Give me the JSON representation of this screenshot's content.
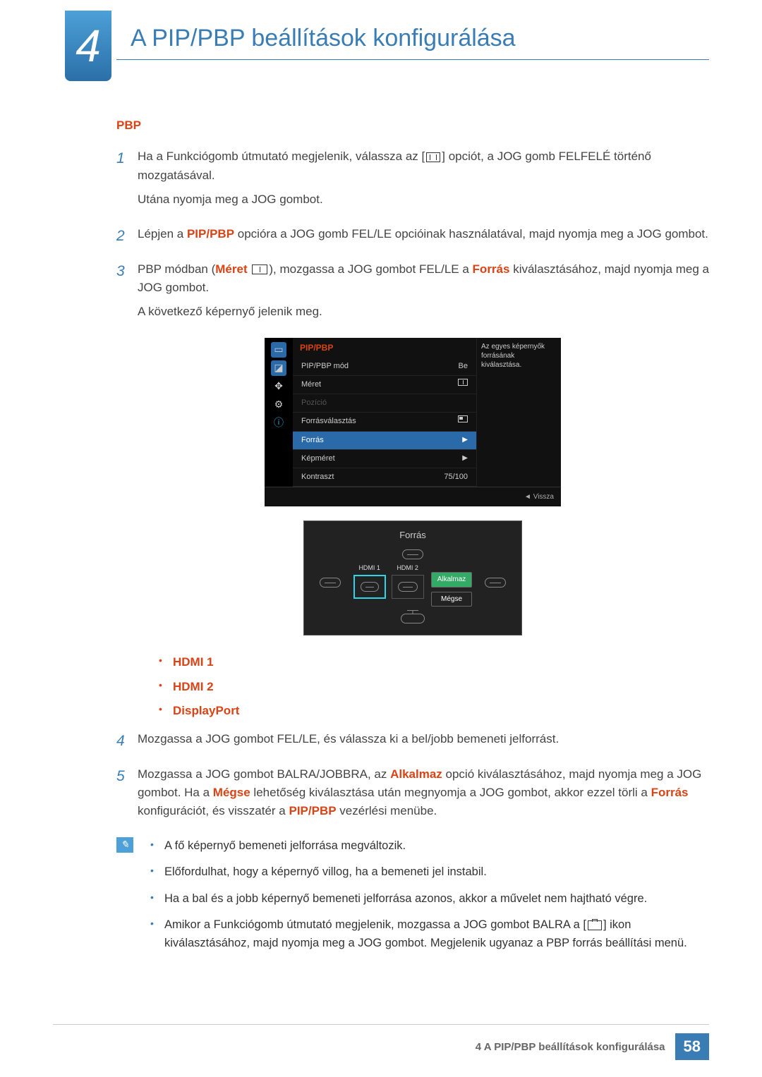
{
  "header": {
    "chapter_number": "4",
    "chapter_title": "A PIP/PBP beállítások konfigurálása"
  },
  "section_label": "PBP",
  "steps": {
    "s1": {
      "num": "1",
      "line1_a": "Ha a Funkciógomb útmutató megjelenik, válassza az [",
      "line1_b": "] opciót, a JOG gomb FELFELÉ történő mozgatásával.",
      "line2": "Utána nyomja meg a JOG gombot."
    },
    "s2": {
      "num": "2",
      "line1_a": "Lépjen a ",
      "kw1": "PIP/PBP",
      "line1_b": " opcióra a JOG gomb FEL/LE opcióinak használatával, majd nyomja meg a JOG gombot."
    },
    "s3": {
      "num": "3",
      "line1_a": "PBP módban (",
      "kw1": "Méret",
      "line1_b": " ",
      "line1_c": "), mozgassa a JOG gombot FEL/LE a ",
      "kw2": "Forrás",
      "line1_d": " kiválasztásához, majd nyomja meg a JOG gombot.",
      "line2": "A következő képernyő jelenik meg."
    },
    "s4": {
      "num": "4",
      "text": "Mozgassa a JOG gombot FEL/LE, és válassza ki a bel/jobb bemeneti jelforrást."
    },
    "s5": {
      "num": "5",
      "line1_a": "Mozgassa a JOG gombot BALRA/JOBBRA, az ",
      "kw1": "Alkalmaz",
      "line1_b": " opció kiválasztásához, majd nyomja meg a JOG gombot. Ha a ",
      "kw2": "Mégse",
      "line1_c": " lehetőség kiválasztása után megnyomja a JOG gombot, akkor ezzel törli a ",
      "kw3": "Forrás",
      "line1_d": " konfigurációt, és visszatér a ",
      "kw4": "PIP/PBP",
      "line1_e": " vezérlési menübe."
    }
  },
  "osd": {
    "title": "PIP/PBP",
    "rows": {
      "mode": {
        "label": "PIP/PBP mód",
        "value": "Be"
      },
      "size": {
        "label": "Méret"
      },
      "position": {
        "label": "Pozíció"
      },
      "source_sel": {
        "label": "Forrásválasztás"
      },
      "source": {
        "label": "Forrás"
      },
      "picsize": {
        "label": "Képméret"
      },
      "contrast": {
        "label": "Kontraszt",
        "value": "75/100"
      }
    },
    "description": "Az egyes képernyők forrásának kiválasztása.",
    "footer": "◄   Vissza"
  },
  "source_dialog": {
    "title": "Forrás",
    "hdmi1": "HDMI  1",
    "hdmi2": "HDMI  2",
    "apply": "Alkalmaz",
    "cancel": "Mégse"
  },
  "port_list": {
    "hdmi1": "HDMI 1",
    "hdmi2": "HDMI 2",
    "dp": "DisplayPort"
  },
  "notes": {
    "n1": "A fő képernyő bemeneti jelforrása megváltozik.",
    "n2": "Előfordulhat, hogy a képernyő villog, ha a bemeneti jel instabil.",
    "n3": "Ha a bal és a jobb képernyő bemeneti jelforrása azonos, akkor a művelet nem hajtható végre.",
    "n4_a": "Amikor a Funkciógomb útmutató megjelenik, mozgassa a JOG gombot BALRA a [",
    "n4_b": "] ikon kiválasztásához, majd nyomja meg a JOG gombot. Megjelenik ugyanaz a PBP forrás beállítási menü."
  },
  "footer": {
    "text": "4 A PIP/PBP beállítások konfigurálása",
    "page": "58"
  }
}
